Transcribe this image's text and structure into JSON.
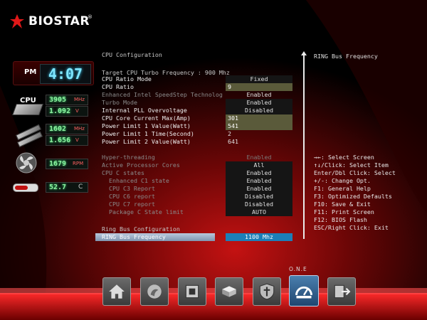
{
  "brand": {
    "name": "BIOSTAR",
    "tm": "®"
  },
  "monitor": {
    "ampm": "PM",
    "time": "4:07",
    "cpu_label": "CPU",
    "cpu_freq": "3905",
    "cpu_freq_unit": "MHz",
    "cpu_volt": "1.092",
    "cpu_volt_unit": "V",
    "mem_freq": "1602",
    "mem_freq_unit": "MHz",
    "mem_volt": "1.656",
    "mem_volt_unit": "V",
    "fan_rpm": "1679",
    "fan_unit": "RPM",
    "temp": "52.7",
    "temp_unit": "C"
  },
  "main": {
    "section_title": "CPU Configuration",
    "turbo_info": "Target CPU Turbo Frequency : 900 Mhz",
    "rows": [
      {
        "label": "CPU Ratio Mode",
        "value": "Fixed"
      },
      {
        "label": "CPU Ratio",
        "value": "9"
      },
      {
        "label": "Enhanced Intel SpeedStep Technolog",
        "value": "Enabled"
      },
      {
        "label": "Turbo Mode",
        "value": "Enabled"
      },
      {
        "label": "Internal PLL Overvoltage",
        "value": "Disabled"
      },
      {
        "label": "CPU Core Current Max(Amp)",
        "value": "301"
      },
      {
        "label": "Power Limit 1 Value(Watt)",
        "value": "541"
      },
      {
        "label": "Power Limit 1 Time(Second)",
        "value": "2"
      },
      {
        "label": "Power Limit 2 Value(Watt)",
        "value": "641"
      }
    ],
    "rows2": [
      {
        "label": "Hyper-threading",
        "value": "Enabled"
      },
      {
        "label": "Active Processor Cores",
        "value": "All"
      },
      {
        "label": "CPU C states",
        "value": "Enabled"
      },
      {
        "label": "Enhanced C1 state",
        "value": "Enabled"
      },
      {
        "label": "CPU C3 Report",
        "value": "Enabled"
      },
      {
        "label": "CPU C6 report",
        "value": "Disabled"
      },
      {
        "label": "CPU C7 report",
        "value": "Disabled"
      },
      {
        "label": "Package C State limit",
        "value": "AUTO"
      }
    ],
    "ring_section": "Ring Bus Configuration",
    "ring_row": {
      "label": "RING Bus Frequency",
      "value": "1100 Mhz"
    }
  },
  "help": {
    "title": "RING Bus Frequency",
    "lines": [
      "→←: Select Screen",
      "↑↓/Click: Select Item",
      "Enter/Dbl Click: Select",
      "+/-: Change Opt.",
      "F1: General Help",
      "F3: Optimized Defaults",
      "F10: Save & Exit",
      "F11: Print Screen",
      "F12: BIOS Flash",
      "ESC/Right Click: Exit"
    ]
  },
  "dock": {
    "active_label": "O.N.E"
  },
  "colors": {
    "accent": "#c01010",
    "selected": "#1c7fb8"
  }
}
